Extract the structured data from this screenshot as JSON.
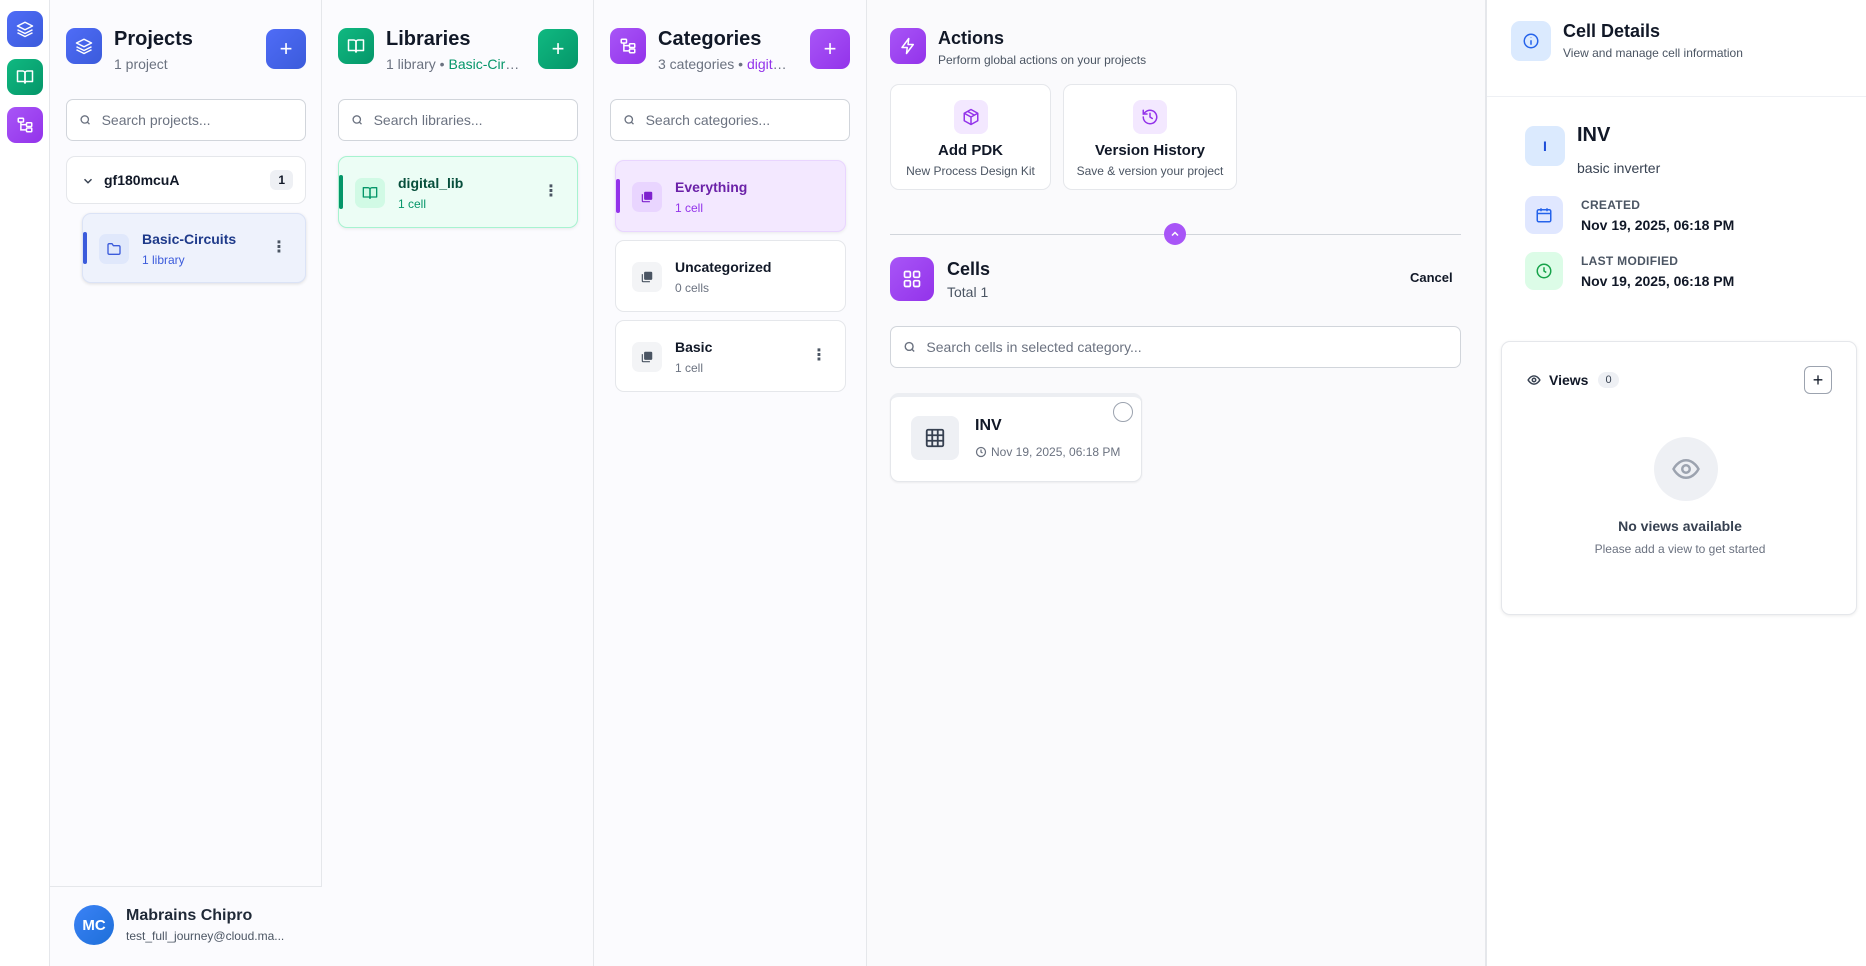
{
  "rail": {
    "items": [
      {
        "icon": "layers-icon"
      },
      {
        "icon": "book-icon"
      },
      {
        "icon": "tree-icon"
      }
    ]
  },
  "projects": {
    "title": "Projects",
    "subtitle": "1 project",
    "add_label": "+",
    "search_placeholder": "Search projects...",
    "group": {
      "name": "gf180mcuA",
      "count": "1"
    },
    "items": [
      {
        "title": "Basic-Circuits",
        "subtitle": "1 library"
      }
    ]
  },
  "libraries": {
    "title": "Libraries",
    "subtitle_prefix": "1 library • ",
    "subtitle_highlight": "Basic-Circuits",
    "add_label": "+",
    "search_placeholder": "Search libraries...",
    "items": [
      {
        "title": "digital_lib",
        "subtitle": "1 cell"
      }
    ]
  },
  "categories": {
    "title": "Categories",
    "subtitle_prefix": "3 categories • ",
    "subtitle_highlight": "digital_lib",
    "add_label": "+",
    "search_placeholder": "Search categories...",
    "items": [
      {
        "title": "Everything",
        "subtitle": "1 cell"
      },
      {
        "title": "Uncategorized",
        "subtitle": "0 cells"
      },
      {
        "title": "Basic",
        "subtitle": "1 cell"
      }
    ]
  },
  "actions": {
    "title": "Actions",
    "subtitle": "Perform global actions on your projects",
    "cards": [
      {
        "title": "Add PDK",
        "subtitle": "New Process Design Kit",
        "icon": "package-icon"
      },
      {
        "title": "Version History",
        "subtitle": "Save & version your project",
        "icon": "history-icon"
      }
    ]
  },
  "cells": {
    "title": "Cells",
    "subtitle": "Total 1",
    "cancel_label": "Cancel",
    "search_placeholder": "Search cells in selected category...",
    "items": [
      {
        "name": "INV",
        "timestamp": "Nov 19, 2025, 06:18 PM"
      }
    ]
  },
  "user": {
    "initials": "MC",
    "name": "Mabrains Chipro",
    "email": "test_full_journey@cloud.ma..."
  },
  "details": {
    "title": "Cell Details",
    "subtitle": "View and manage cell information",
    "cell_initial": "I",
    "cell_name": "INV",
    "cell_description": "basic inverter",
    "created_label": "CREATED",
    "created_value": "Nov 19, 2025, 06:18 PM",
    "modified_label": "LAST MODIFIED",
    "modified_value": "Nov 19, 2025, 06:18 PM",
    "views_label": "Views",
    "views_count": "0",
    "views_add": "+",
    "empty_title": "No views available",
    "empty_sub": "Please add a view to get started"
  },
  "colors": {
    "projects_accent": "#3b5bdb",
    "libraries_accent": "#059669",
    "categories_accent": "#9333ea"
  }
}
